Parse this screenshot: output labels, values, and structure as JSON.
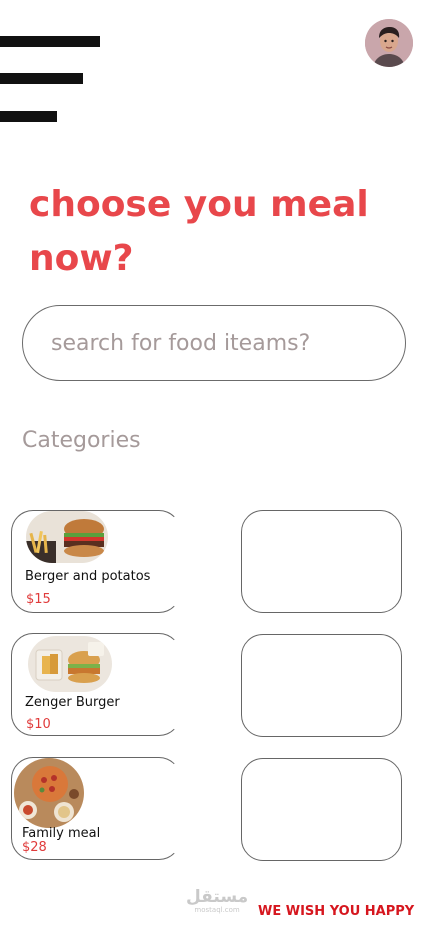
{
  "header": {
    "menu_icon": "hamburger-menu-icon",
    "avatar_icon": "user-avatar"
  },
  "hero": {
    "title_line1": "choose you meal",
    "title_line2": "now?"
  },
  "search": {
    "placeholder": "search for food iteams?"
  },
  "categories": {
    "label": "Categories"
  },
  "items": [
    {
      "name": "Berger and potatos",
      "price": "$15"
    },
    {
      "name": "Zenger Burger",
      "price": "$10"
    },
    {
      "name": "Family meal",
      "price": "$28"
    }
  ],
  "watermark": {
    "arabic": "مستقل",
    "latin": "mostaql.com"
  },
  "footer": {
    "tagline": "WE WISH YOU HAPPY"
  },
  "colors": {
    "accent": "#e8474b",
    "price": "#e03b3b",
    "tagline": "#d6161e",
    "muted_text": "#a59a9a"
  }
}
